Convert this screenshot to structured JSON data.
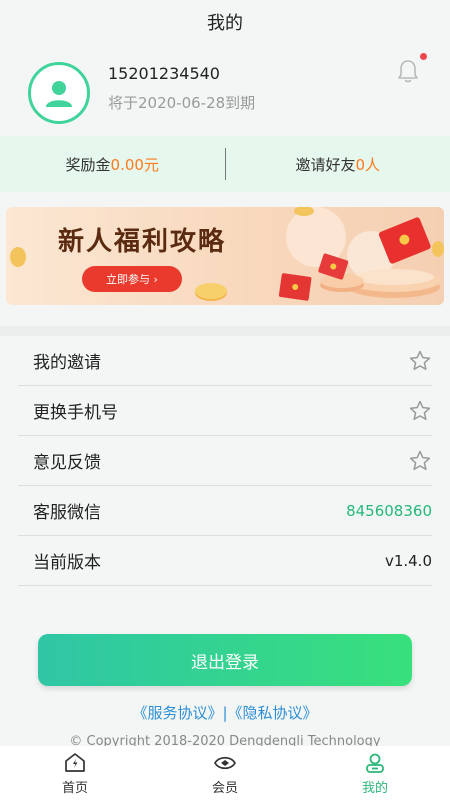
{
  "header": {
    "title": "我的"
  },
  "profile": {
    "phone": "15201234540",
    "expiry": "将于2020-06-28到期"
  },
  "stats": {
    "reward_label": "奖励金",
    "reward_value": "0.00元",
    "invite_label": "邀请好友",
    "invite_value": "0人"
  },
  "banner": {
    "title": "新人福利攻略",
    "button": "立即参与 ›"
  },
  "menu": {
    "items": [
      {
        "label": "我的邀请",
        "icon": "star-icon"
      },
      {
        "label": "更换手机号",
        "icon": "star-icon"
      },
      {
        "label": "意见反馈",
        "icon": "star-icon"
      },
      {
        "label": "客服微信",
        "value": "845608360"
      },
      {
        "label": "当前版本",
        "value": "v1.4.0"
      }
    ]
  },
  "logout": {
    "label": "退出登录"
  },
  "agreements": {
    "service": "《服务协议》",
    "separator": "|",
    "privacy": "《隐私协议》"
  },
  "copyright": "© Copyright 2018-2020 Dengdengli Technology",
  "tabs": [
    {
      "label": "首页",
      "icon": "home-icon"
    },
    {
      "label": "会员",
      "icon": "eye-icon"
    },
    {
      "label": "我的",
      "icon": "user-icon",
      "active": true
    }
  ],
  "colors": {
    "accent_green": "#40d39a",
    "orange_value": "#ff7a1a",
    "link_blue": "#2c8fd6"
  }
}
